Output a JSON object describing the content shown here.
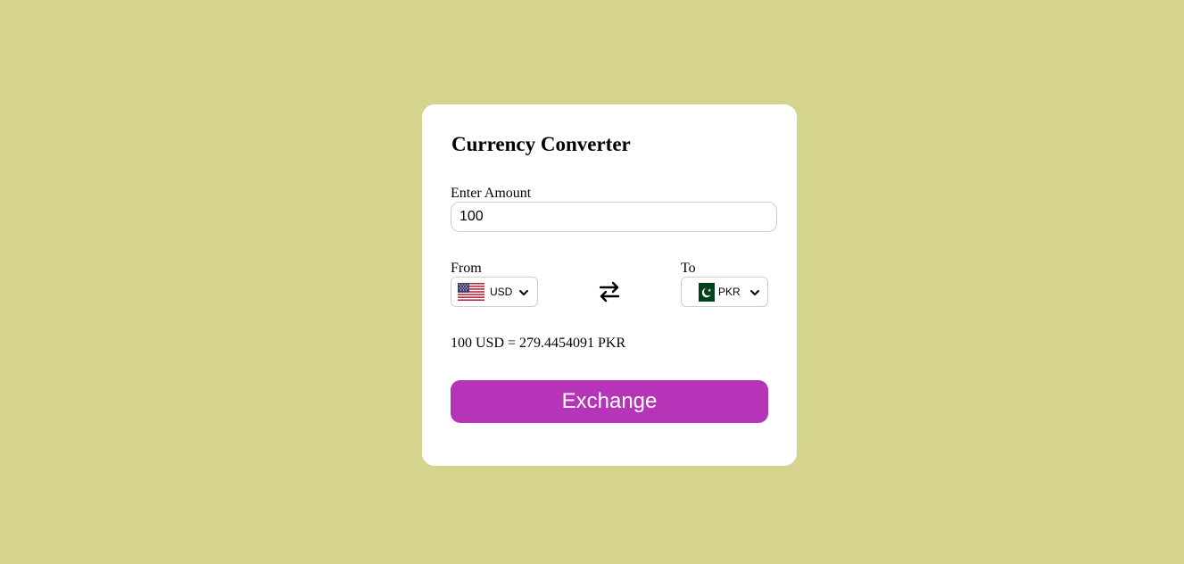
{
  "app": {
    "title": "Currency Converter"
  },
  "amount": {
    "label": "Enter Amount",
    "value": "100"
  },
  "from": {
    "label": "From",
    "currency": "USD",
    "flag_icon": "us-flag-icon"
  },
  "to": {
    "label": "To",
    "currency": "PKR",
    "flag_icon": "pk-flag-icon"
  },
  "swap_icon": "swap-arrows-icon",
  "result": {
    "text": "100 USD = 279.4454091 PKR"
  },
  "exchange_button": {
    "label": "Exchange"
  },
  "colors": {
    "background": "#d4d48f",
    "card": "#ffffff",
    "button": "#b634b7",
    "button_text": "#ffffff"
  }
}
